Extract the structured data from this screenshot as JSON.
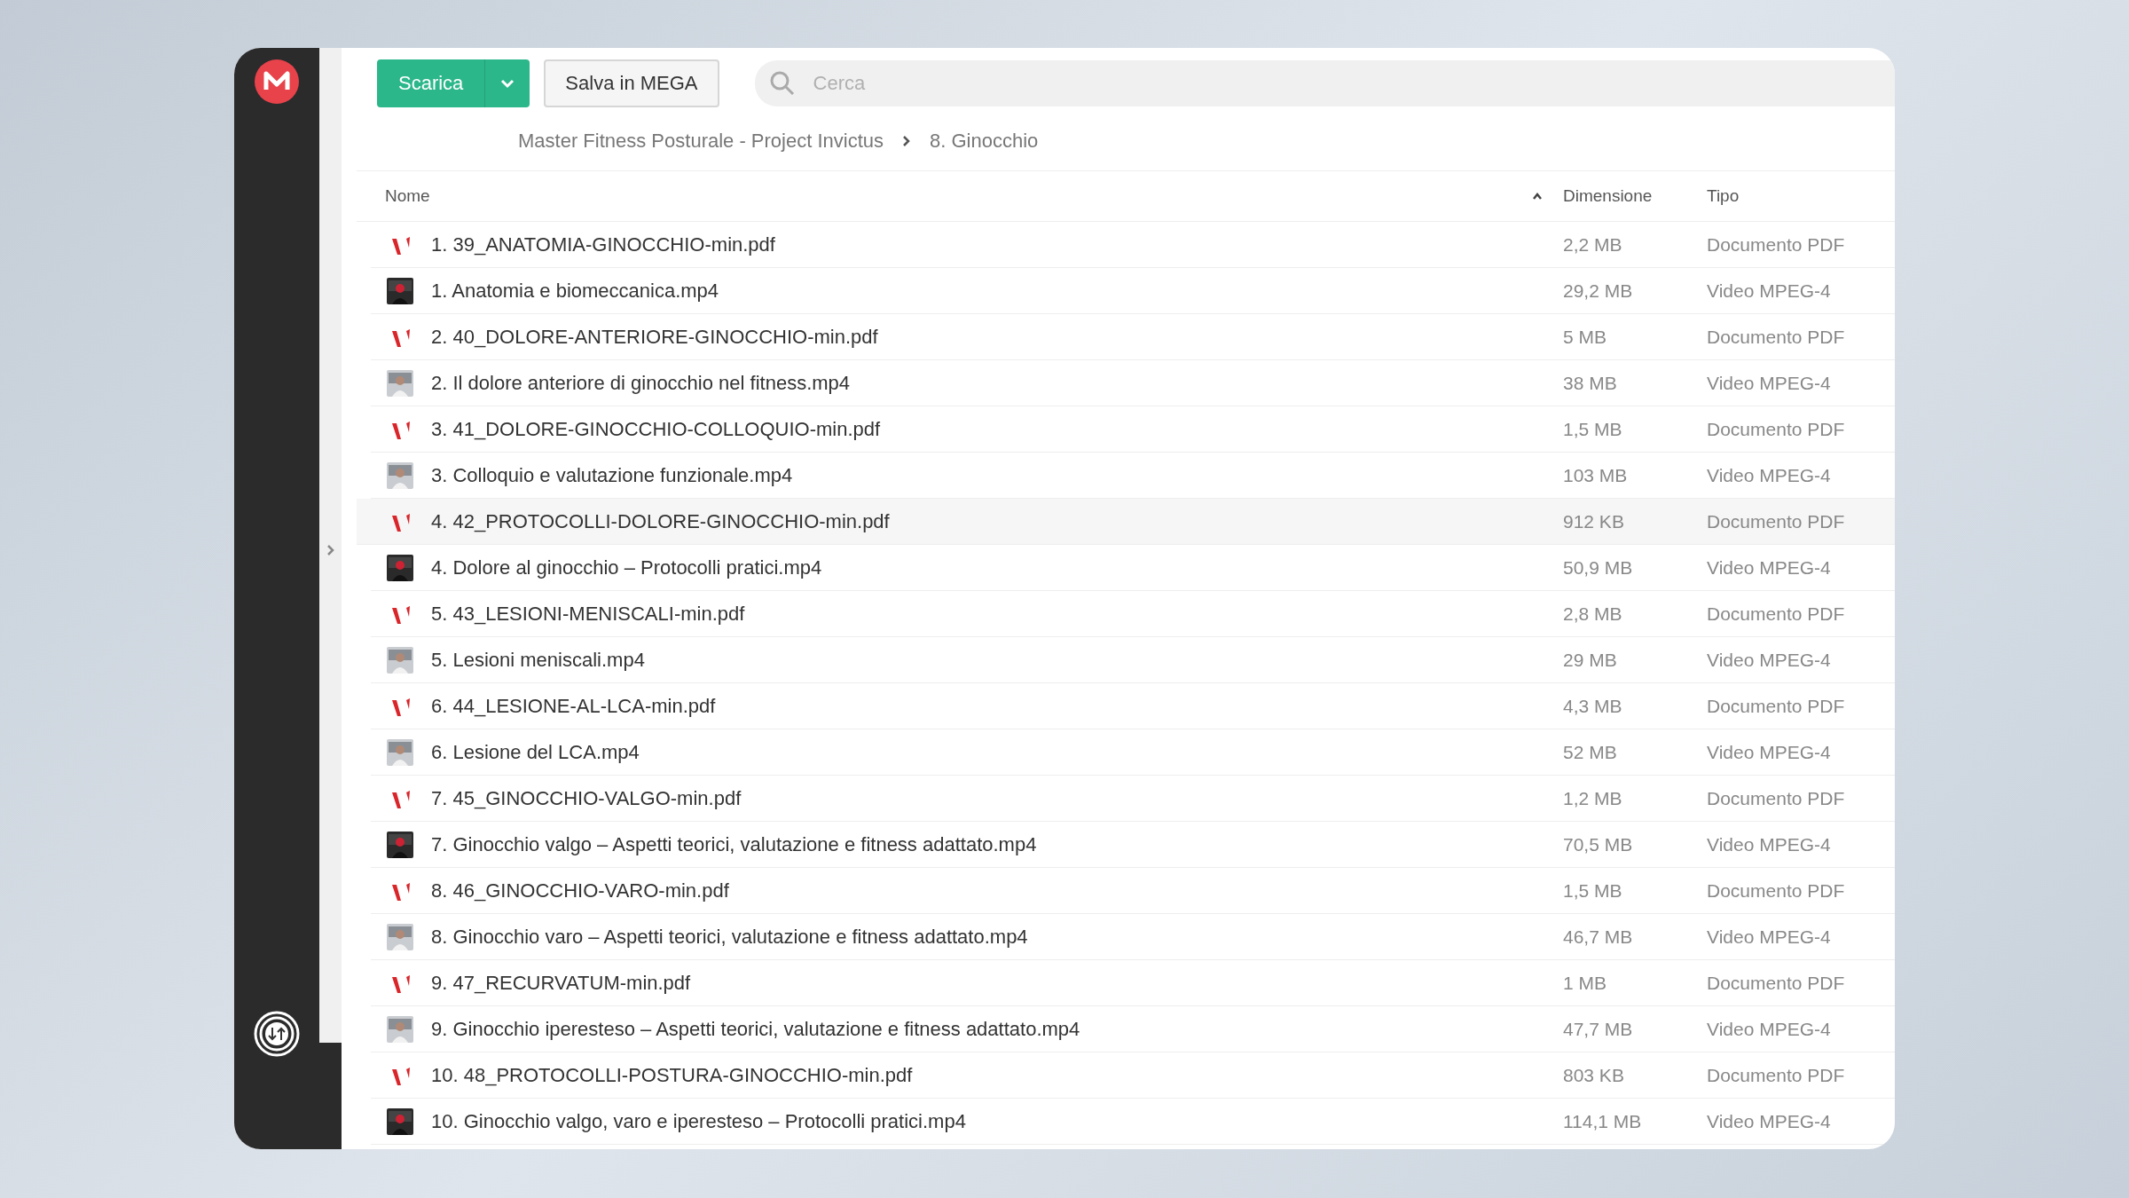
{
  "toolbar": {
    "download_button": "Scarica",
    "save_button": "Salva in MEGA",
    "search": {
      "placeholder": "Cerca"
    }
  },
  "breadcrumb": [
    "Master Fitness Posturale - Project Invictus",
    "8. Ginocchio"
  ],
  "table": {
    "columns": [
      {
        "label": "Nome",
        "sorted": true
      },
      {
        "label": "Dimensione",
        "sorted": false
      },
      {
        "label": "Tipo",
        "sorted": false
      }
    ],
    "rows": [
      {
        "kind": "pdf",
        "name": "1. 39_ANATOMIA-GINOCCHIO-min.pdf",
        "size": "2,2 MB",
        "type": "Documento PDF",
        "selected": false
      },
      {
        "kind": "video",
        "name": "1. Anatomia e biomeccanica.mp4",
        "size": "29,2 MB",
        "type": "Video MPEG-4",
        "selected": false
      },
      {
        "kind": "pdf",
        "name": "2. 40_DOLORE-ANTERIORE-GINOCCHIO-min.pdf",
        "size": "5 MB",
        "type": "Documento PDF",
        "selected": false
      },
      {
        "kind": "video",
        "name": "2. Il dolore anteriore di ginocchio nel fitness.mp4",
        "size": "38 MB",
        "type": "Video MPEG-4",
        "selected": false
      },
      {
        "kind": "pdf",
        "name": "3. 41_DOLORE-GINOCCHIO-COLLOQUIO-min.pdf",
        "size": "1,5 MB",
        "type": "Documento PDF",
        "selected": false
      },
      {
        "kind": "video",
        "name": "3. Colloquio e valutazione funzionale.mp4",
        "size": "103 MB",
        "type": "Video MPEG-4",
        "selected": false
      },
      {
        "kind": "pdf",
        "name": "4. 42_PROTOCOLLI-DOLORE-GINOCCHIO-min.pdf",
        "size": "912 KB",
        "type": "Documento PDF",
        "selected": true
      },
      {
        "kind": "video",
        "name": "4. Dolore al ginocchio – Protocolli pratici.mp4",
        "size": "50,9 MB",
        "type": "Video MPEG-4",
        "selected": false
      },
      {
        "kind": "pdf",
        "name": "5. 43_LESIONI-MENISCALI-min.pdf",
        "size": "2,8 MB",
        "type": "Documento PDF",
        "selected": false
      },
      {
        "kind": "video",
        "name": "5. Lesioni meniscali.mp4",
        "size": "29 MB",
        "type": "Video MPEG-4",
        "selected": false
      },
      {
        "kind": "pdf",
        "name": "6. 44_LESIONE-AL-LCA-min.pdf",
        "size": "4,3 MB",
        "type": "Documento PDF",
        "selected": false
      },
      {
        "kind": "video",
        "name": "6. Lesione del LCA.mp4",
        "size": "52 MB",
        "type": "Video MPEG-4",
        "selected": false
      },
      {
        "kind": "pdf",
        "name": "7. 45_GINOCCHIO-VALGO-min.pdf",
        "size": "1,2 MB",
        "type": "Documento PDF",
        "selected": false
      },
      {
        "kind": "video",
        "name": "7. Ginocchio valgo – Aspetti teorici, valutazione e fitness adattato.mp4",
        "size": "70,5 MB",
        "type": "Video MPEG-4",
        "selected": false
      },
      {
        "kind": "pdf",
        "name": "8. 46_GINOCCHIO-VARO-min.pdf",
        "size": "1,5 MB",
        "type": "Documento PDF",
        "selected": false
      },
      {
        "kind": "video",
        "name": "8. Ginocchio varo – Aspetti teorici, valutazione e fitness adattato.mp4",
        "size": "46,7 MB",
        "type": "Video MPEG-4",
        "selected": false
      },
      {
        "kind": "pdf",
        "name": "9. 47_RECURVATUM-min.pdf",
        "size": "1 MB",
        "type": "Documento PDF",
        "selected": false
      },
      {
        "kind": "video",
        "name": "9. Ginocchio iperesteso – Aspetti teorici, valutazione e fitness adattato.mp4",
        "size": "47,7 MB",
        "type": "Video MPEG-4",
        "selected": false
      },
      {
        "kind": "pdf",
        "name": "10. 48_PROTOCOLLI-POSTURA-GINOCCHIO-min.pdf",
        "size": "803 KB",
        "type": "Documento PDF",
        "selected": false
      },
      {
        "kind": "video",
        "name": "10. Ginocchio valgo, varo e iperesteso – Protocolli pratici.mp4",
        "size": "114,1 MB",
        "type": "Video MPEG-4",
        "selected": false
      }
    ]
  }
}
